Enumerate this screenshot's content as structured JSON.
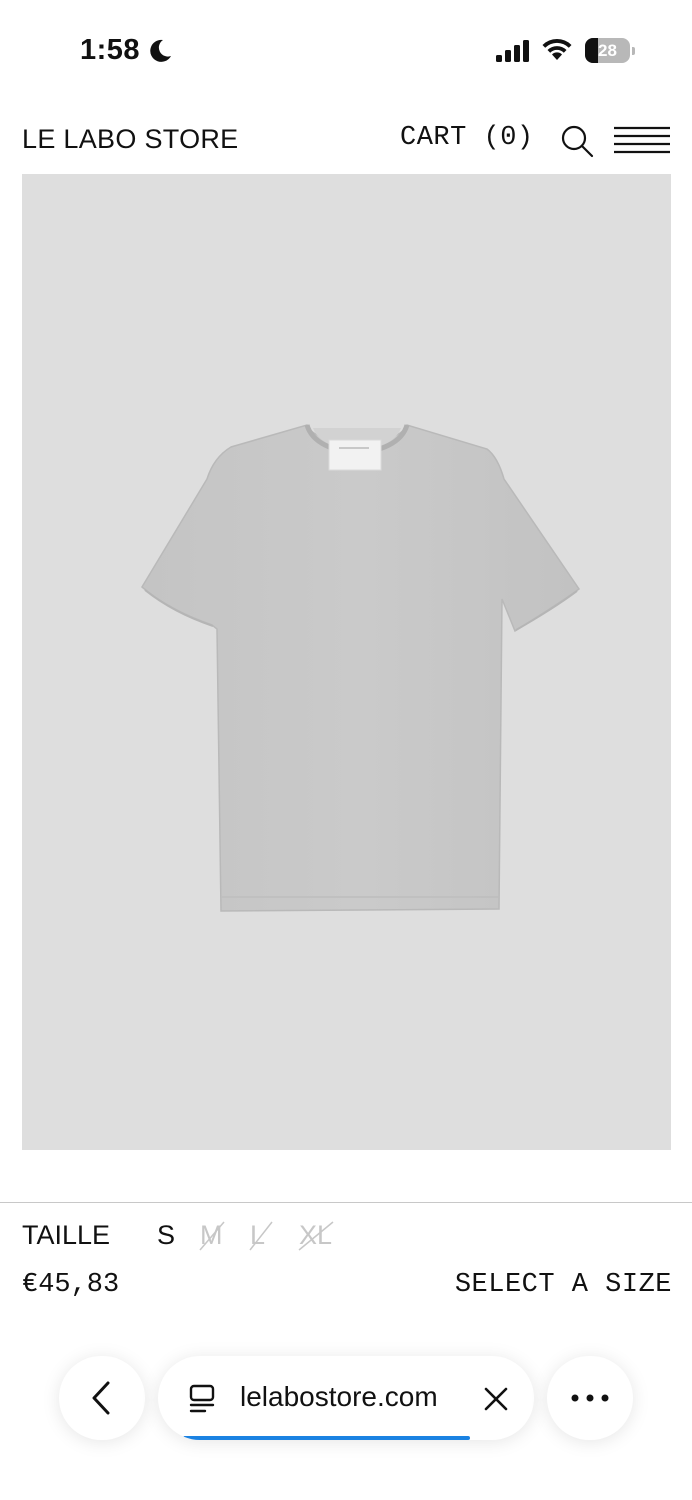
{
  "status_bar": {
    "time": "1:58",
    "battery_level": "28",
    "icons": [
      "moon-icon",
      "signal-icon",
      "wifi-icon",
      "battery-icon"
    ]
  },
  "header": {
    "store_title": "LE LABO STORE",
    "cart_label": "CART (0)",
    "icons": [
      "search-icon",
      "menu-icon"
    ]
  },
  "product": {
    "image_alt": "grey t-shirt",
    "image_background": "#dedede",
    "size_label": "TAILLE",
    "sizes": [
      {
        "label": "S",
        "available": true
      },
      {
        "label": "M",
        "available": false
      },
      {
        "label": "L",
        "available": false
      },
      {
        "label": "XL",
        "available": false
      }
    ],
    "price": "€45,83",
    "select_size_label": "SELECT A SIZE"
  },
  "browser": {
    "url": "lelabostore.com",
    "load_progress": 0.88,
    "accent_color": "#1a82e2",
    "icons": [
      "chevron-left-icon",
      "tabs-icon",
      "close-icon",
      "more-icon"
    ]
  }
}
